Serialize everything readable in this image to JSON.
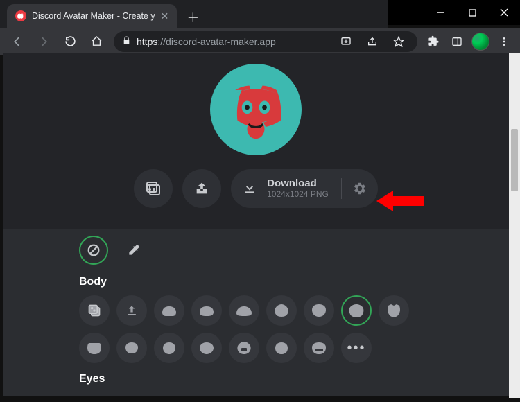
{
  "window": {
    "title": "Discord Avatar Maker - Create your own"
  },
  "browser": {
    "tab_title": "Discord Avatar Maker - Create y",
    "url_secure_part": "https",
    "url_rest": "://discord-avatar-maker.app"
  },
  "hero": {
    "avatar_bg": "#3db9b0",
    "avatar_accent": "#d83a3c",
    "actions": {
      "random": "random-icon",
      "share": "share-icon",
      "download_label": "Download",
      "download_sub": "1024x1024 PNG",
      "settings": "gear-icon"
    }
  },
  "sections": {
    "body_label": "Body",
    "eyes_label": "Eyes"
  },
  "body_options": {
    "row1": [
      "random",
      "upload",
      "body-a",
      "body-b",
      "body-c",
      "body-d",
      "body-e",
      "body-sel",
      "body-f"
    ],
    "row2": [
      "body-g",
      "body-h",
      "body-i",
      "body-j",
      "body-k",
      "body-l",
      "body-m",
      "more"
    ]
  },
  "selected_body_index": 7
}
